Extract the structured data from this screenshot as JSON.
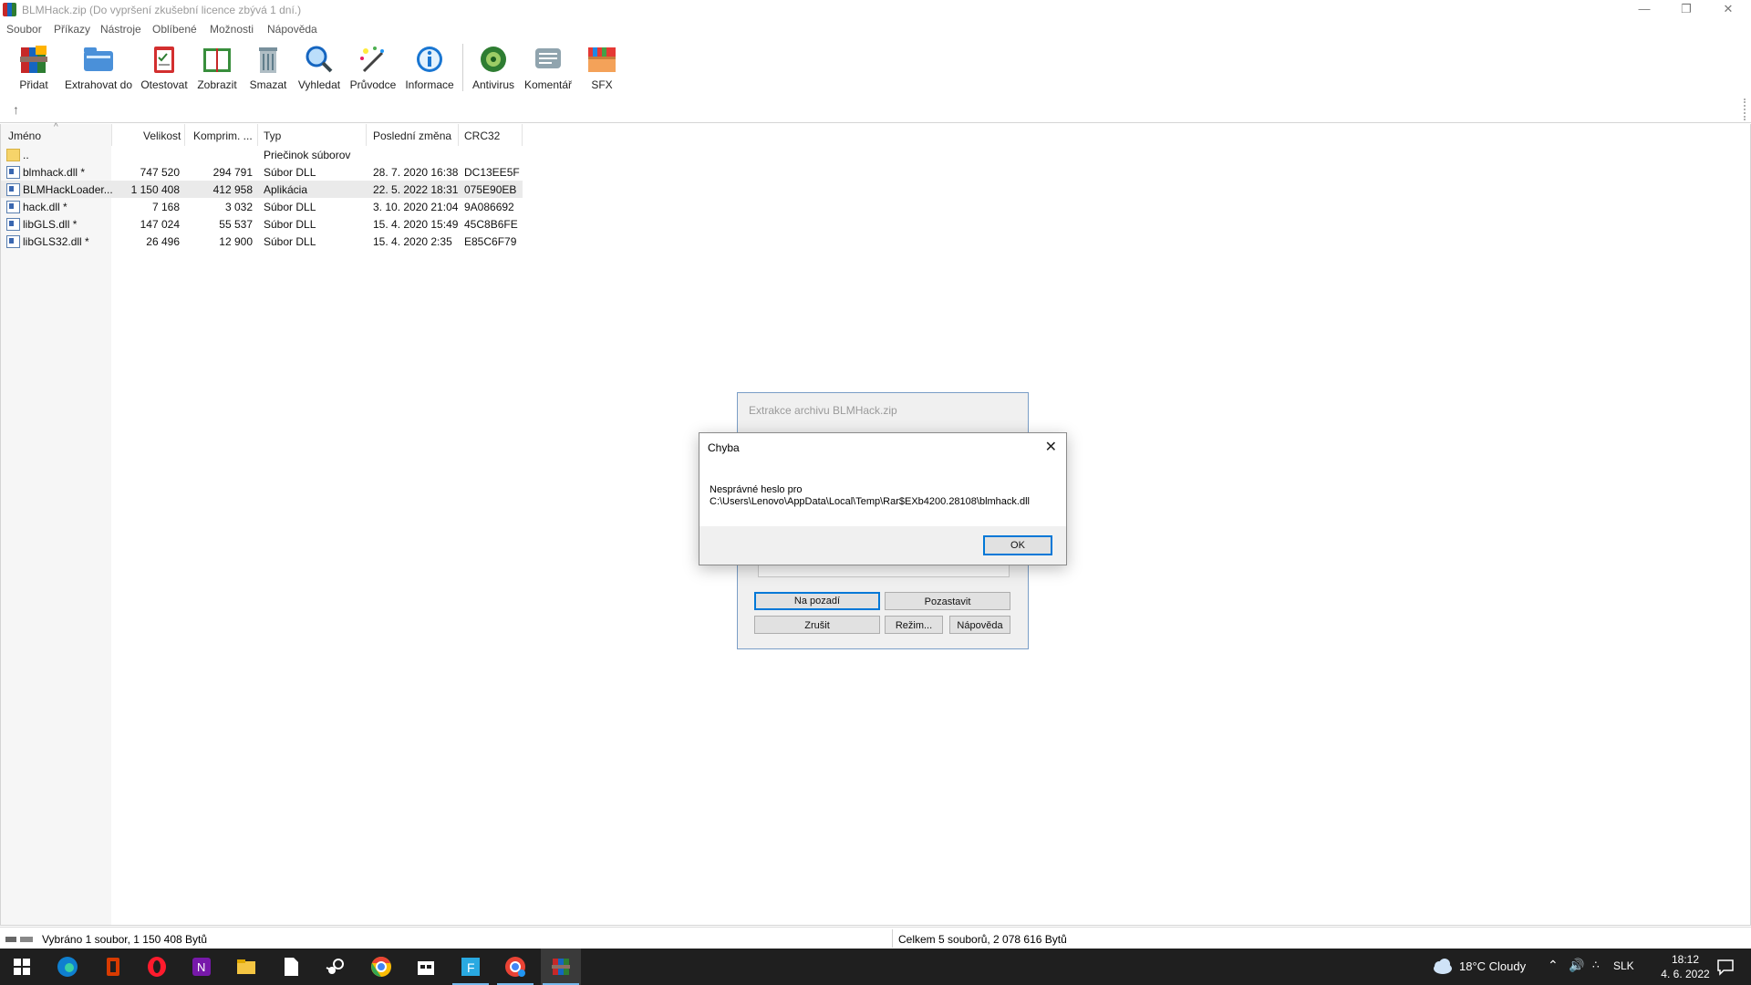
{
  "window": {
    "title": "BLMHack.zip (Do vypršení zkušební licence zbývá 1 dní.)"
  },
  "menu": [
    "Soubor",
    "Příkazy",
    "Nástroje",
    "Oblíbené",
    "Možnosti",
    "Nápověda"
  ],
  "toolbar": [
    {
      "label": "Přidat",
      "icon": "add-archive-icon"
    },
    {
      "label": "Extrahovat do",
      "icon": "extract-folder-icon"
    },
    {
      "label": "Otestovat",
      "icon": "test-clipboard-icon"
    },
    {
      "label": "Zobrazit",
      "icon": "view-book-icon"
    },
    {
      "label": "Smazat",
      "icon": "trash-icon"
    },
    {
      "label": "Vyhledat",
      "icon": "search-magnifier-icon"
    },
    {
      "label": "Průvodce",
      "icon": "wizard-wand-icon"
    },
    {
      "label": "Informace",
      "icon": "info-icon"
    },
    {
      "label": "Antivirus",
      "icon": "antivirus-icon"
    },
    {
      "label": "Komentář",
      "icon": "comment-icon"
    },
    {
      "label": "SFX",
      "icon": "sfx-box-icon"
    }
  ],
  "columns": [
    "Jméno",
    "Velikost",
    "Komprim. ...",
    "Typ",
    "Poslední změna",
    "CRC32"
  ],
  "files": [
    {
      "name": "..",
      "size": "",
      "packed": "",
      "type": "Priečinok súborov",
      "modified": "",
      "crc": "",
      "icon": "folder-icon"
    },
    {
      "name": "blmhack.dll *",
      "size": "747 520",
      "packed": "294 791",
      "type": "Súbor DLL",
      "modified": "28. 7. 2020 16:38",
      "crc": "DC13EE5F",
      "icon": "dll-file-icon"
    },
    {
      "name": "BLMHackLoader...",
      "size": "1 150 408",
      "packed": "412 958",
      "type": "Aplikácia",
      "modified": "22. 5. 2022 18:31",
      "crc": "075E90EB",
      "icon": "app-file-icon",
      "selected": true
    },
    {
      "name": "hack.dll *",
      "size": "7 168",
      "packed": "3 032",
      "type": "Súbor DLL",
      "modified": "3. 10. 2020 21:04",
      "crc": "9A086692",
      "icon": "dll-file-icon"
    },
    {
      "name": "libGLS.dll *",
      "size": "147 024",
      "packed": "55 537",
      "type": "Súbor DLL",
      "modified": "15. 4. 2020 15:49",
      "crc": "45C8B6FE",
      "icon": "dll-file-icon"
    },
    {
      "name": "libGLS32.dll *",
      "size": "26 496",
      "packed": "12 900",
      "type": "Súbor DLL",
      "modified": "15. 4. 2020 2:35",
      "crc": "E85C6F79",
      "icon": "dll-file-icon"
    }
  ],
  "status": {
    "left": "Vybráno 1 soubor, 1 150 408 Bytů",
    "right": "Celkem 5 souborů, 2 078 616 Bytů"
  },
  "extract_dialog": {
    "title": "Extrakce archivu BLMHack.zip",
    "buttons": {
      "background": "Na pozadí",
      "pause": "Pozastavit",
      "cancel": "Zrušit",
      "mode": "Režim...",
      "help": "Nápověda"
    }
  },
  "error_dialog": {
    "title": "Chyba",
    "message_line1": "Nesprávné heslo pro",
    "message_line2": "C:\\Users\\Lenovo\\AppData\\Local\\Temp\\Rar$EXb4200.28108\\blmhack.dll",
    "ok": "OK"
  },
  "taskbar": {
    "weather": "18°C  Cloudy",
    "lang": "SLK",
    "time": "18:12",
    "date": "4. 6. 2022"
  },
  "colors": {
    "accent": "#0078d7",
    "taskbar": "#1f1f1f",
    "selection": "#eaeaea"
  }
}
